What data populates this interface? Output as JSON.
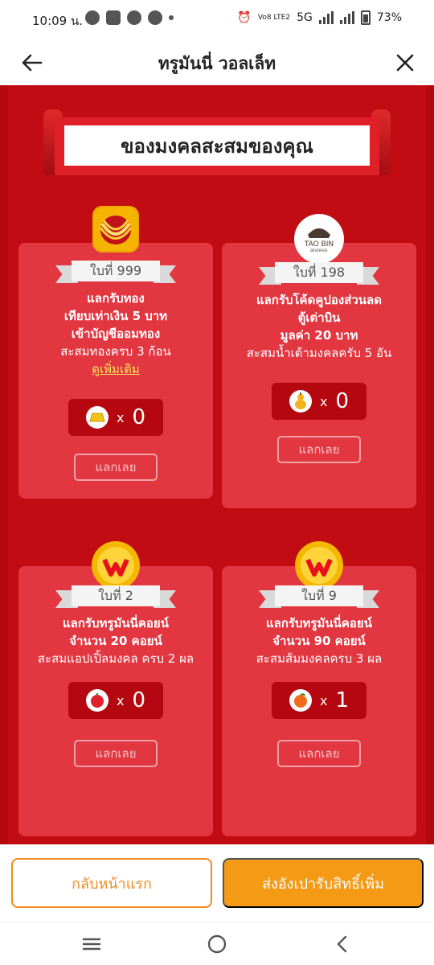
{
  "status": {
    "time": "10:09 น.",
    "network": "5G",
    "volte": "Vo8 LTE2",
    "battery": "73%"
  },
  "header": {
    "title": "ทรูมันนี่ วอลเล็ท",
    "back_icon": "arrow-left-icon",
    "close_icon": "close-icon"
  },
  "banner": {
    "title": "ของมงคลสะสมของคุณ"
  },
  "cards": [
    {
      "emblem": "gold-necklace",
      "ribbon": "ใบที่ 999",
      "lines": [
        "แลกรับทอง",
        "เทียบเท่าเงิน 5 บาท",
        "เข้าบัญชีออมทอง"
      ],
      "sub": "สะสมทองครบ 3 ก้อน",
      "link": "ดูเพิ่มเติม",
      "item_icon": "gold-bar-icon",
      "x": "x",
      "count": "0",
      "button": "แลกเลย"
    },
    {
      "emblem": "taobin-logo",
      "emblem_text": "TAO BIN",
      "emblem_sub": "BEVERAGE",
      "ribbon": "ใบที่ 198",
      "lines": [
        "แลกรับโค้ดคูปองส่วนลด",
        "ตู้เต่าบิน",
        "มูลค่า 20 บาท"
      ],
      "sub": "สะสมน้ำเต้ามงคลครับ 5 อัน",
      "item_icon": "gourd-icon",
      "x": "x",
      "count": "0",
      "button": "แลกเลย"
    },
    {
      "emblem": "truemoney-coin",
      "ribbon": "ใบที่ 2",
      "lines": [
        "แลกรับทรูมันนี่คอยน์",
        "จำนวน 20 คอยน์"
      ],
      "sub": "สะสมแอปเปิ้ลมงคล ครบ 2 ผล",
      "item_icon": "apple-icon",
      "x": "x",
      "count": "0",
      "button": "แลกเลย"
    },
    {
      "emblem": "truemoney-coin",
      "ribbon": "ใบที่ 9",
      "lines": [
        "แลกรับทรูมันนี่คอยน์",
        "จำนวน 90 คอยน์"
      ],
      "sub": "สะสมส้มมงคลครบ 3 ผล",
      "item_icon": "orange-icon",
      "x": "x",
      "count": "1",
      "button": "แลกเลย"
    }
  ],
  "actions": {
    "home": "กลับหน้าแรก",
    "send": "ส่งอังเปารับสิทธิ์เพิ่ม"
  },
  "colors": {
    "background_red": "#b3080d",
    "card_red": "#e23641",
    "orange": "#f59a15"
  }
}
